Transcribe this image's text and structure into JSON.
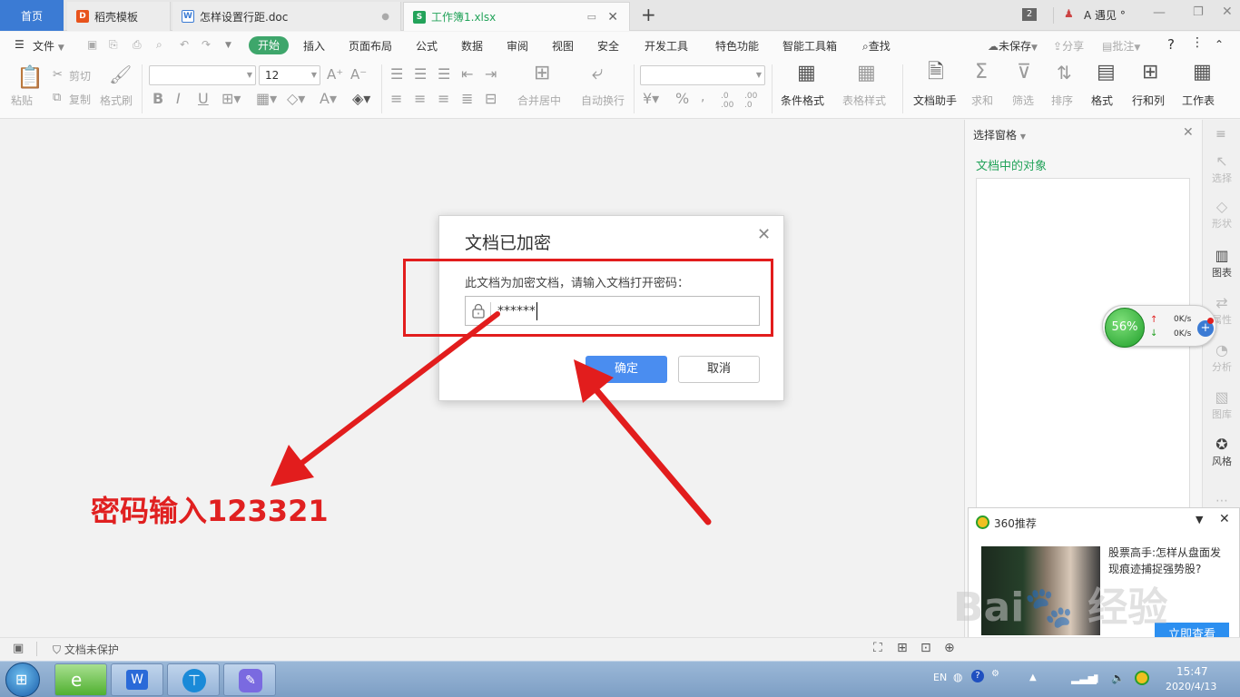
{
  "tabs": {
    "home": "首页",
    "template": "稻壳模板",
    "doc": "怎样设置行距.doc",
    "sheet": "工作簿1.xlsx",
    "new_tab": "+"
  },
  "titlebar": {
    "badge": "2",
    "user": "A  遇见 °"
  },
  "menu": {
    "file": "文件",
    "start": "开始",
    "items": [
      "插入",
      "页面布局",
      "公式",
      "数据",
      "审阅",
      "视图",
      "安全",
      "开发工具",
      "特色功能",
      "智能工具箱"
    ],
    "find": "查找",
    "unsaved": "未保存",
    "share": "分享",
    "comment": "批注",
    "help": "?"
  },
  "ribbon": {
    "paste": "粘贴",
    "cut": "剪切",
    "copy": "复制",
    "format_painter": "格式刷",
    "font_size": "12",
    "merge_center": "合并居中",
    "wrap_text": "自动换行",
    "cond_format": "条件格式",
    "table_style": "表格样式",
    "doc_helper": "文档助手",
    "sum": "求和",
    "filter": "筛选",
    "sort": "排序",
    "format": "格式",
    "rowcol": "行和列",
    "worksheet": "工作表",
    "percent": "%",
    "thousands": ",",
    "dec_inc": ".0 .00",
    "dec_dec": ".00 .0"
  },
  "panel": {
    "title": "选择窗格",
    "section": "文档中的对象"
  },
  "sidebar": [
    "选择",
    "形状",
    "图表",
    "属性",
    "分析",
    "图库",
    "风格"
  ],
  "dialog": {
    "title": "文档已加密",
    "prompt": "此文档为加密文档，请输入文档打开密码：",
    "password": "******",
    "ok": "确定",
    "cancel": "取消"
  },
  "annotation": "密码输入123321",
  "netwidget": {
    "percent": "56%",
    "up": "0K/s",
    "down": "0K/s"
  },
  "popup360": {
    "title": "360推荐",
    "headline": "股票高手:怎样从盘面发现痕迹捕捉强势股?",
    "button": "立即查看"
  },
  "statusbar": {
    "protect": "文档未保护"
  },
  "taskbar": {
    "lang": "EN",
    "time": "15:47",
    "date": "2020/4/13"
  },
  "watermark": "Baidu 经验 jingyan.baidu.com",
  "colors": {
    "accent_green": "#3ea66b",
    "primary_blue": "#4a8df0",
    "annotation_red": "#e21d1d"
  }
}
